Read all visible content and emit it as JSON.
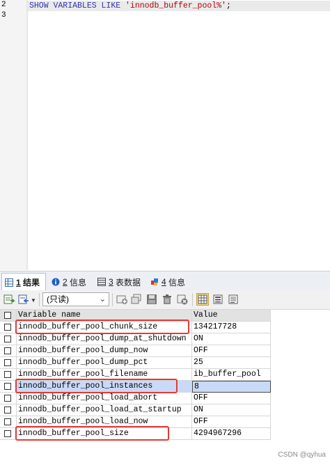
{
  "editor": {
    "line_numbers": [
      "2",
      "3"
    ],
    "query": {
      "keyword": "SHOW VARIABLES LIKE",
      "literal": "'innodb_buffer_pool%'",
      "terminator": ";"
    }
  },
  "tabs": [
    {
      "num": "1",
      "label": "结果",
      "icon": "result-grid-icon"
    },
    {
      "num": "2",
      "label": "信息",
      "icon": "info-icon"
    },
    {
      "num": "3",
      "label": "表数据",
      "icon": "table-data-icon"
    },
    {
      "num": "4",
      "label": "信息",
      "icon": "info-puzzle-icon"
    }
  ],
  "toolbar": {
    "mode": "(只读)",
    "buttons": [
      "export-icon",
      "import-icon",
      "add-row-icon",
      "copy-row-icon",
      "save-icon",
      "delete-icon",
      "cancel-icon",
      "grid-view-icon",
      "form-view-icon",
      "text-view-icon"
    ]
  },
  "grid": {
    "columns": [
      "Variable name",
      "Value"
    ],
    "rows": [
      {
        "name": "innodb_buffer_pool_chunk_size",
        "value": "134217728"
      },
      {
        "name": "innodb_buffer_pool_dump_at_shutdown",
        "value": "ON"
      },
      {
        "name": "innodb_buffer_pool_dump_now",
        "value": "OFF"
      },
      {
        "name": "innodb_buffer_pool_dump_pct",
        "value": "25"
      },
      {
        "name": "innodb_buffer_pool_filename",
        "value": "ib_buffer_pool"
      },
      {
        "name": "innodb_buffer_pool_instances",
        "value": "8"
      },
      {
        "name": "innodb_buffer_pool_load_abort",
        "value": "OFF"
      },
      {
        "name": "innodb_buffer_pool_load_at_startup",
        "value": "ON"
      },
      {
        "name": "innodb_buffer_pool_load_now",
        "value": "OFF"
      },
      {
        "name": "innodb_buffer_pool_size",
        "value": "4294967296"
      }
    ]
  },
  "colors": {
    "highlight": "#e53935",
    "selection": "#c9daf8",
    "keyword": "#3232b4",
    "string": "#b1000b"
  },
  "watermark": "CSDN @qyhua"
}
